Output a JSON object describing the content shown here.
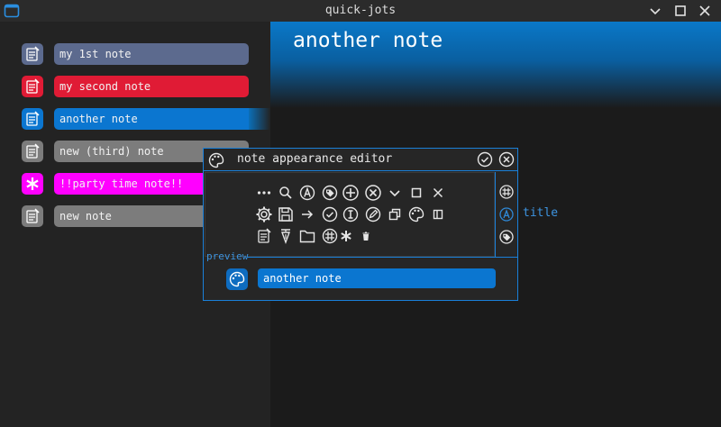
{
  "window": {
    "title": "quick-jots"
  },
  "notes": [
    {
      "label": "my 1st note",
      "icon": "note-edit-icon",
      "color": "#5c6a8e"
    },
    {
      "label": "my second note",
      "icon": "note-edit-icon",
      "color": "#e01b35"
    },
    {
      "label": "another note",
      "icon": "note-edit-icon",
      "color": "#0b76d0"
    },
    {
      "label": "new (third) note",
      "icon": "note-edit-icon",
      "color": "#7c7c7c"
    },
    {
      "label": "!!party time note!!",
      "icon": "asterisk-icon",
      "color": "#ff00ff"
    },
    {
      "label": "new note",
      "icon": "note-edit-icon",
      "color": "#7c7c7c"
    }
  ],
  "main": {
    "title": "another note"
  },
  "dialog": {
    "title": "note appearance editor",
    "preview_label": "preview",
    "preview_text": "another note",
    "side_label": "title",
    "icon_grid": [
      "more-dots-icon",
      "search-icon",
      "circle-a-icon",
      "tag-circle-icon",
      "plus-circle-icon",
      "x-circle-icon",
      "chevron-down-icon",
      "square-icon",
      "close-x-icon",
      "gear-icon",
      "save-icon",
      "arrow-right-icon",
      "check-circle-icon",
      "info-circle-icon",
      "pencil-circle-icon",
      "copy-icon",
      "palette-icon",
      "panel-icon",
      "note-edit-icon",
      "pen-nib-icon",
      "folder-icon",
      "grid-circle-icon",
      "asterisk-icon",
      "trash-icon"
    ]
  },
  "colors": {
    "accent": "#1a80d9",
    "selected": "#0b76d0",
    "magenta": "#ff00ff",
    "red": "#e01b35",
    "slate": "#5c6a8e",
    "gray": "#7c7c7c"
  }
}
